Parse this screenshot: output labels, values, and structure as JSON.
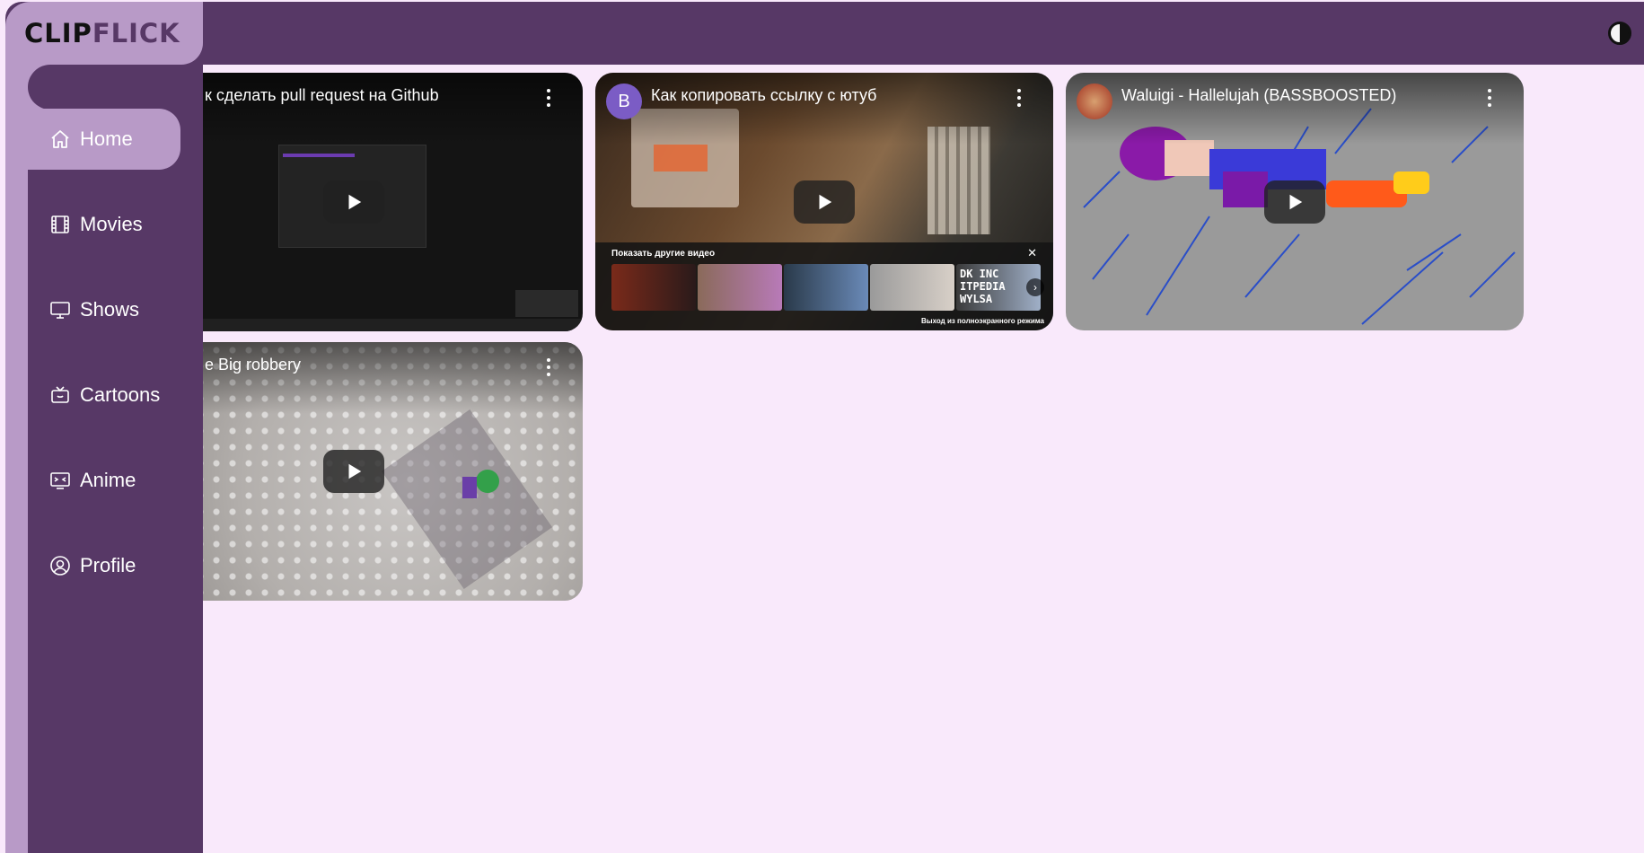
{
  "app": {
    "logo_main": "CLIP",
    "logo_accent": "FLICK"
  },
  "colors": {
    "page_bg": "#f9e9fb",
    "primary_dark": "#573866",
    "primary_light": "#b89ac7"
  },
  "sidebar": {
    "items": [
      {
        "label": "Home",
        "icon": "home-icon",
        "active": true
      },
      {
        "label": "Movies",
        "icon": "film-icon",
        "active": false
      },
      {
        "label": "Shows",
        "icon": "monitor-icon",
        "active": false
      },
      {
        "label": "Cartoons",
        "icon": "tv-icon",
        "active": false
      },
      {
        "label": "Anime",
        "icon": "anime-icon",
        "active": false
      },
      {
        "label": "Profile",
        "icon": "user-circle-icon",
        "active": false
      }
    ]
  },
  "videos": [
    {
      "title": "к сделать pull request на Github"
    },
    {
      "title": "Как копировать ссылку с ютуб",
      "avatar_letter": "B"
    },
    {
      "title": "Waluigi - Hallelujah (BASSBOOSTED)"
    },
    {
      "title": "e Big robbery"
    }
  ],
  "more_videos": {
    "title": "Показать другие видео",
    "close": "✕",
    "exit_label": "Выход из полноэкранного режима",
    "thumb_text": "DK INC\nITPEDIA\nWYLSA"
  }
}
